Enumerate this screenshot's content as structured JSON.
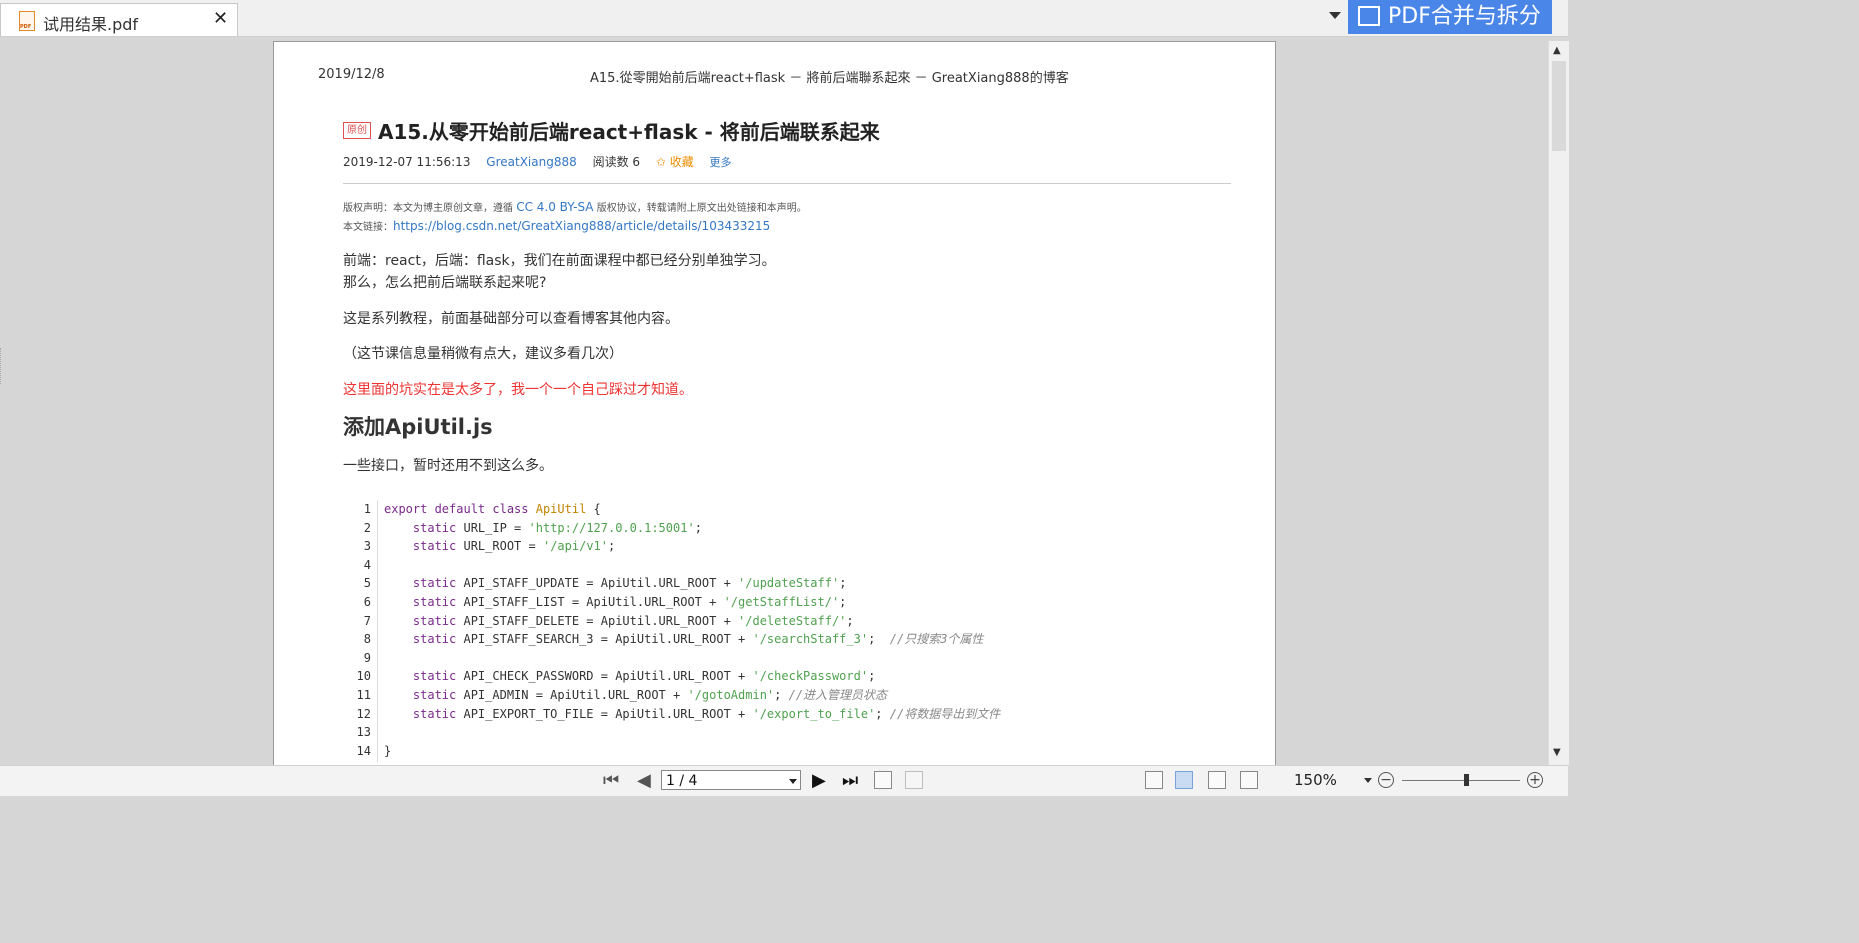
{
  "tab": {
    "title": "试用结果.pdf",
    "close": "✕"
  },
  "brand_button": {
    "label": "PDF合并与拆分"
  },
  "page_header": {
    "date": "2019/12/8",
    "title": "A15.從零開始前后端react+flask － 將前后端聯系起來 － GreatXiang888的博客"
  },
  "article": {
    "badge": "原创",
    "title": "A15.从零开始前后端react+flask - 将前后端联系起来",
    "datetime": "2019-12-07 11:56:13",
    "author": "GreatXiang888",
    "reads": "阅读数 6",
    "favorite": "✩ 收藏",
    "more": "更多",
    "copyright_prefix": "版权声明：本文为博主原创文章，遵循 ",
    "license": "CC 4.0 BY-SA",
    "copyright_suffix": " 版权协议，转载请附上原文出处链接和本声明。",
    "link_label": "本文链接：",
    "link_url": "https://blog.csdn.net/GreatXiang888/article/details/103433215",
    "p1": "前端：react，后端：flask，我们在前面课程中都已经分别单独学习。",
    "p2": "那么，怎么把前后端联系起来呢?",
    "p3": "这是系列教程，前面基础部分可以查看博客其他内容。",
    "p4": "（这节课信息量稍微有点大，建议多看几次）",
    "p5": "这里面的坑实在是太多了，我一个一个自己踩过才知道。",
    "h2": "添加ApiUtil.js",
    "p6": "一些接口，暂时还用不到这么多。"
  },
  "code": [
    {
      "n": "1",
      "parts": [
        [
          "kw",
          "export default class "
        ],
        [
          "cls",
          "ApiUtil"
        ],
        [
          "t",
          " {"
        ]
      ]
    },
    {
      "n": "2",
      "parts": [
        [
          "kw",
          "    static "
        ],
        [
          "t",
          "URL_IP = "
        ],
        [
          "str",
          "'http://127.0.0.1:5001'"
        ],
        [
          "t",
          ";"
        ]
      ]
    },
    {
      "n": "3",
      "parts": [
        [
          "kw",
          "    static "
        ],
        [
          "t",
          "URL_ROOT = "
        ],
        [
          "str",
          "'/api/v1'"
        ],
        [
          "t",
          ";"
        ]
      ]
    },
    {
      "n": "4",
      "parts": []
    },
    {
      "n": "5",
      "parts": [
        [
          "kw",
          "    static "
        ],
        [
          "t",
          "API_STAFF_UPDATE = ApiUtil.URL_ROOT + "
        ],
        [
          "str",
          "'/updateStaff'"
        ],
        [
          "t",
          ";"
        ]
      ]
    },
    {
      "n": "6",
      "parts": [
        [
          "kw",
          "    static "
        ],
        [
          "t",
          "API_STAFF_LIST = ApiUtil.URL_ROOT + "
        ],
        [
          "str",
          "'/getStaffList/'"
        ],
        [
          "t",
          ";"
        ]
      ]
    },
    {
      "n": "7",
      "parts": [
        [
          "kw",
          "    static "
        ],
        [
          "t",
          "API_STAFF_DELETE = ApiUtil.URL_ROOT + "
        ],
        [
          "str",
          "'/deleteStaff/'"
        ],
        [
          "t",
          ";"
        ]
      ]
    },
    {
      "n": "8",
      "parts": [
        [
          "kw",
          "    static "
        ],
        [
          "t",
          "API_STAFF_SEARCH_3 = ApiUtil.URL_ROOT + "
        ],
        [
          "str",
          "'/searchStaff_3'"
        ],
        [
          "t",
          ";  "
        ],
        [
          "cmt",
          "//只搜索3个属性"
        ]
      ]
    },
    {
      "n": "9",
      "parts": []
    },
    {
      "n": "10",
      "parts": [
        [
          "kw",
          "    static "
        ],
        [
          "t",
          "API_CHECK_PASSWORD = ApiUtil.URL_ROOT + "
        ],
        [
          "str",
          "'/checkPassword'"
        ],
        [
          "t",
          ";"
        ]
      ]
    },
    {
      "n": "11",
      "parts": [
        [
          "kw",
          "    static "
        ],
        [
          "t",
          "API_ADMIN = ApiUtil.URL_ROOT + "
        ],
        [
          "str",
          "'/gotoAdmin'"
        ],
        [
          "t",
          "; "
        ],
        [
          "cmt",
          "//进入管理员状态"
        ]
      ]
    },
    {
      "n": "12",
      "parts": [
        [
          "kw",
          "    static "
        ],
        [
          "t",
          "API_EXPORT_TO_FILE = ApiUtil.URL_ROOT + "
        ],
        [
          "str",
          "'/export_to_file'"
        ],
        [
          "t",
          "; "
        ],
        [
          "cmt",
          "//将数据导出到文件"
        ]
      ]
    },
    {
      "n": "13",
      "parts": []
    },
    {
      "n": "14",
      "parts": [
        [
          "t",
          "}"
        ]
      ]
    }
  ],
  "bottom": {
    "page_value": "1 / 4",
    "zoom": "150%"
  },
  "icons": {
    "first": "first-page-icon",
    "prev": "prev-page-icon",
    "next": "next-page-icon",
    "last": "last-page-icon",
    "zoom_out": "zoom-out-icon",
    "zoom_in": "zoom-in-icon"
  },
  "colors": {
    "accent": "#4a86e8",
    "link": "#3477c4",
    "warning_text": "#e33333"
  }
}
